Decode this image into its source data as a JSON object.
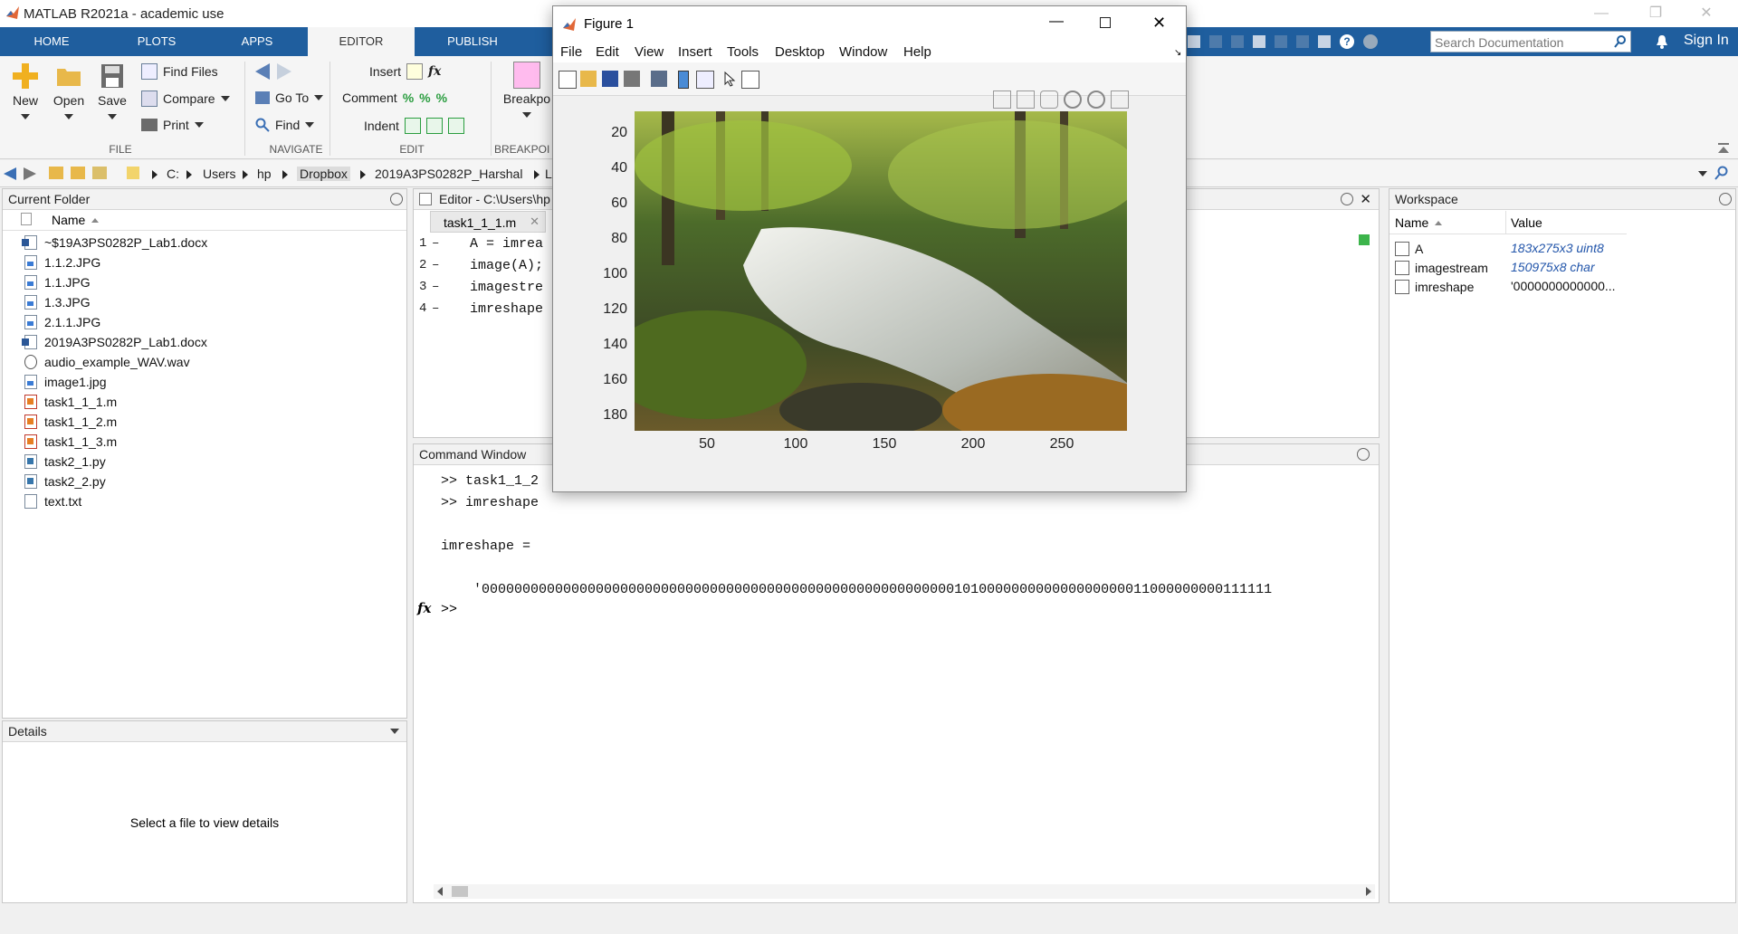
{
  "window": {
    "title": "MATLAB R2021a - academic use"
  },
  "ribbon": {
    "tabs": [
      "HOME",
      "PLOTS",
      "APPS",
      "EDITOR",
      "PUBLISH"
    ],
    "file": {
      "new": "New",
      "open": "Open",
      "save": "Save",
      "find_files": "Find Files",
      "compare": "Compare",
      "print": "Print",
      "label": "FILE"
    },
    "navigate": {
      "go_to": "Go To",
      "find": "Find",
      "label": "NAVIGATE"
    },
    "edit": {
      "insert": "Insert",
      "comment": "Comment",
      "indent": "Indent",
      "label": "EDIT"
    },
    "breakpoints": {
      "label_btn": "Breakpo",
      "label": "BREAKPOI"
    },
    "search": {
      "placeholder": "Search Documentation"
    },
    "sign_in": "Sign In"
  },
  "address": {
    "crumbs": [
      "C:",
      "Users",
      "hp",
      "Dropbox",
      "2019A3PS0282P_Harshal",
      "L"
    ]
  },
  "current_folder": {
    "title": "Current Folder",
    "column": "Name",
    "files": [
      {
        "name": "~$19A3PS0282P_Lab1.docx",
        "type": "doc"
      },
      {
        "name": "1.1.2.JPG",
        "type": "img"
      },
      {
        "name": "1.1.JPG",
        "type": "img"
      },
      {
        "name": "1.3.JPG",
        "type": "img"
      },
      {
        "name": "2.1.1.JPG",
        "type": "img"
      },
      {
        "name": "2019A3PS0282P_Lab1.docx",
        "type": "doc"
      },
      {
        "name": "audio_example_WAV.wav",
        "type": "wav"
      },
      {
        "name": "image1.jpg",
        "type": "img"
      },
      {
        "name": "task1_1_1.m",
        "type": "m"
      },
      {
        "name": "task1_1_2.m",
        "type": "m"
      },
      {
        "name": "task1_1_3.m",
        "type": "m"
      },
      {
        "name": "task2_1.py",
        "type": "py"
      },
      {
        "name": "task2_2.py",
        "type": "py"
      },
      {
        "name": "text.txt",
        "type": "txt"
      }
    ]
  },
  "details": {
    "title": "Details",
    "empty_text": "Select a file to view details"
  },
  "editor": {
    "title": "Editor - C:\\Users\\hp",
    "tab": "task1_1_1.m",
    "lines": [
      {
        "num": "1",
        "code": "A = imrea"
      },
      {
        "num": "2",
        "code": "image(A);"
      },
      {
        "num": "3",
        "code": "imagestre"
      },
      {
        "num": "4",
        "code": "imreshape"
      }
    ]
  },
  "command_window": {
    "title": "Command Window",
    "lines": [
      ">> task1_1_2",
      ">> imreshape",
      "",
      "imreshape =",
      "",
      "    '0000000000000000000000000000000000000000000000000000000000101000000000000000000011000000000111111"
    ],
    "prompt": ">>"
  },
  "figure": {
    "title": "Figure 1",
    "menu": [
      "File",
      "Edit",
      "View",
      "Insert",
      "Tools",
      "Desktop",
      "Window",
      "Help"
    ],
    "y_ticks": [
      "20",
      "40",
      "60",
      "80",
      "100",
      "120",
      "140",
      "160",
      "180"
    ],
    "x_ticks": [
      "50",
      "100",
      "150",
      "200",
      "250"
    ]
  },
  "workspace": {
    "title": "Workspace",
    "columns": [
      "Name",
      "Value"
    ],
    "vars": [
      {
        "name": "A",
        "value": "183x275x3 uint8"
      },
      {
        "name": "imagestream",
        "value": "150975x8 char"
      },
      {
        "name": "imreshape",
        "value": "'0000000000000..."
      }
    ]
  },
  "colors": {
    "ribbon_blue": "#1f5e9e",
    "workspace_value": "#2255aa"
  }
}
